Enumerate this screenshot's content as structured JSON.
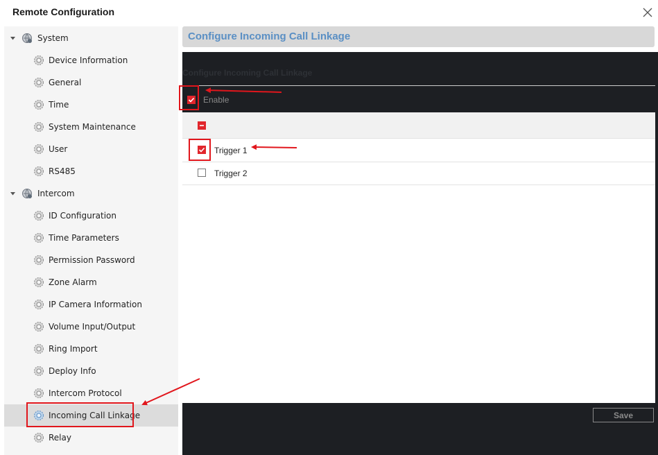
{
  "window": {
    "title": "Remote Configuration",
    "close_icon": "close-icon"
  },
  "sidebar": {
    "groups": [
      {
        "label": "System",
        "items": [
          "Device Information",
          "General",
          "Time",
          "System Maintenance",
          "User",
          "RS485"
        ]
      },
      {
        "label": "Intercom",
        "items": [
          "ID Configuration",
          "Time Parameters",
          "Permission Password",
          "Zone Alarm",
          "IP Camera Information",
          "Volume Input/Output",
          "Ring Import",
          "Deploy Info",
          "Intercom Protocol",
          "Incoming Call Linkage",
          "Relay"
        ]
      }
    ],
    "selected": "Incoming Call Linkage"
  },
  "main": {
    "header": "Configure Incoming Call Linkage",
    "section_title": "Configure Incoming Call Linkage",
    "enable": {
      "label": "Enable",
      "checked": true
    },
    "triggers": [
      {
        "label": "Trigger 1",
        "checked": true
      },
      {
        "label": "Trigger 2",
        "checked": false
      }
    ],
    "save_label": "Save"
  },
  "colors": {
    "accent_red": "#e1262c",
    "header_text": "#5a8fc4",
    "dark_bg": "#1d1f23",
    "annotation": "#e1161c"
  }
}
